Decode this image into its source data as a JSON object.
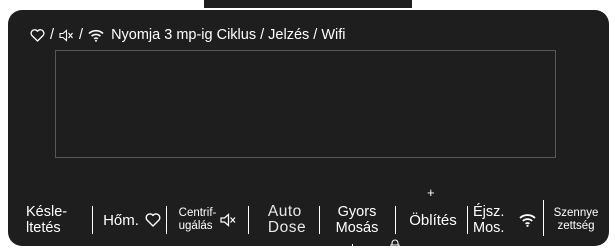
{
  "header": {
    "text": "Nyomja 3 mp-ig Ciklus / Jelzés / Wifi",
    "icons": [
      "heart-icon",
      "speaker-mute-icon",
      "wifi-icon"
    ],
    "separators": [
      "/",
      "/"
    ]
  },
  "controls": {
    "delay": [
      "Késle-",
      "ltetés"
    ],
    "temp": "Hőm.",
    "spin": [
      "Centrif-",
      "ugálás"
    ],
    "auto_dose": [
      "Auto",
      "Dose"
    ],
    "quick_wash": [
      "Gyors",
      "Mosás"
    ],
    "rinse_plus": "+",
    "rinse": "Öblítés",
    "night": [
      "Éjsz.",
      "Mos."
    ],
    "soil": [
      "Szennye",
      "zettség"
    ]
  },
  "colors": {
    "panel": "#1e1e1e",
    "text": "#ffffff",
    "display_border": "#585858"
  }
}
